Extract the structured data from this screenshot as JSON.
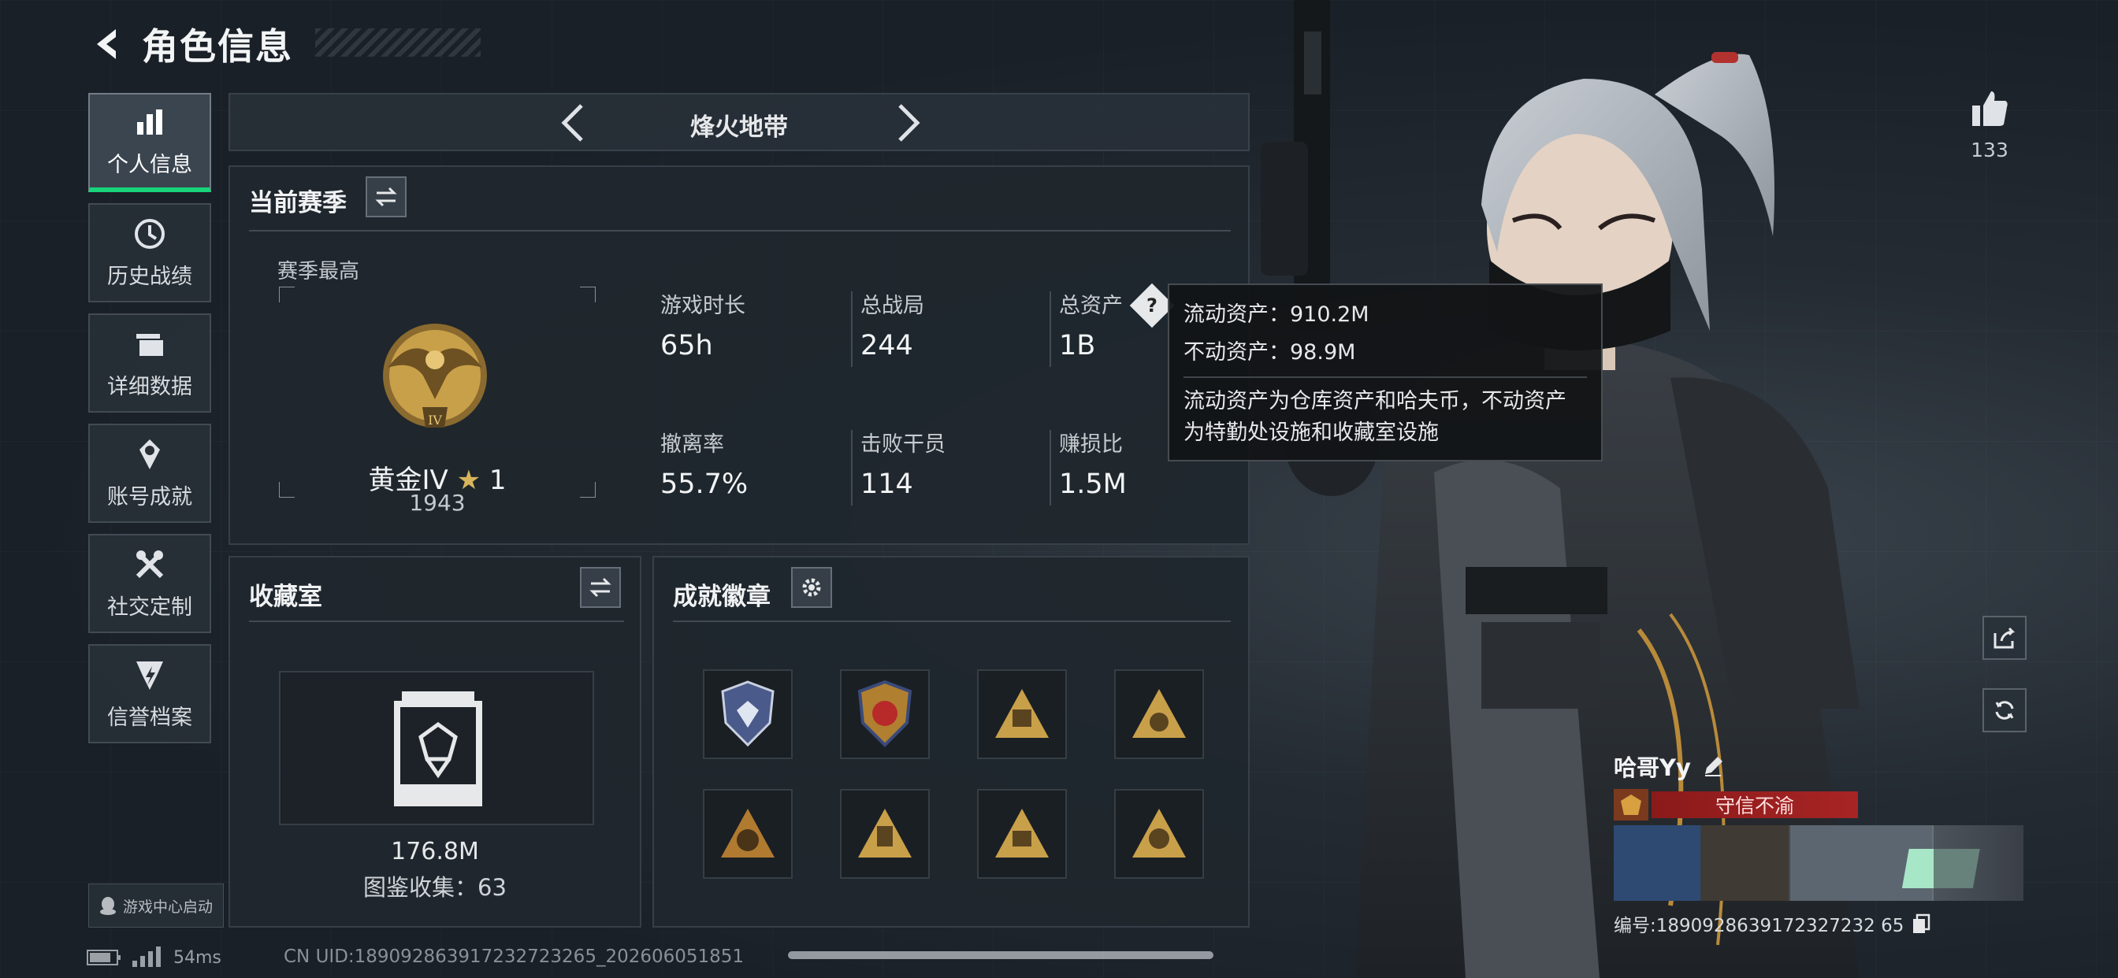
{
  "header": {
    "title": "角色信息"
  },
  "nav": {
    "items": [
      {
        "label": "个人信息",
        "icon": "bar-chart-icon",
        "active": true
      },
      {
        "label": "历史战绩",
        "icon": "history-icon"
      },
      {
        "label": "详细数据",
        "icon": "folder-icon"
      },
      {
        "label": "账号成就",
        "icon": "achievement-icon"
      },
      {
        "label": "社交定制",
        "icon": "tools-icon"
      },
      {
        "label": "信誉档案",
        "icon": "credit-icon"
      }
    ],
    "game_center": "游戏中心启动"
  },
  "mode": {
    "title": "烽火地带"
  },
  "season": {
    "title": "当前赛季",
    "best_label": "赛季最高",
    "rank_name": "黄金IV",
    "rank_stars": "1",
    "rank_score": "1943",
    "stats": [
      {
        "label": "游戏时长",
        "value": "65h"
      },
      {
        "label": "总战局",
        "value": "244"
      },
      {
        "label": "总资产",
        "value": "1B"
      },
      {
        "label": "撤离率",
        "value": "55.7%"
      },
      {
        "label": "击败干员",
        "value": "114"
      },
      {
        "label": "赚损比",
        "value": "1.5M"
      }
    ]
  },
  "tooltip": {
    "liquid": "流动资产：910.2M",
    "fixed": "不动资产：98.9M",
    "desc_line1": "流动资产为仓库资产和哈夫币，不动资产",
    "desc_line2": "为特勤处设施和收藏室设施"
  },
  "collection": {
    "title": "收藏室",
    "value": "176.8M",
    "count": "图鉴收集：63"
  },
  "badges": {
    "title": "成就徽章"
  },
  "profile": {
    "likes": "133",
    "name": "哈哥Yy",
    "title_tag": "守信不渝",
    "uid": "编号:1890928639172327232 65"
  },
  "footer": {
    "ping": "54ms",
    "uid": "CN UID:189092863917232723265_202606051851"
  },
  "colors": {
    "accent": "#18d47a",
    "gold": "#c9a04a",
    "title_red": "#a82424"
  }
}
